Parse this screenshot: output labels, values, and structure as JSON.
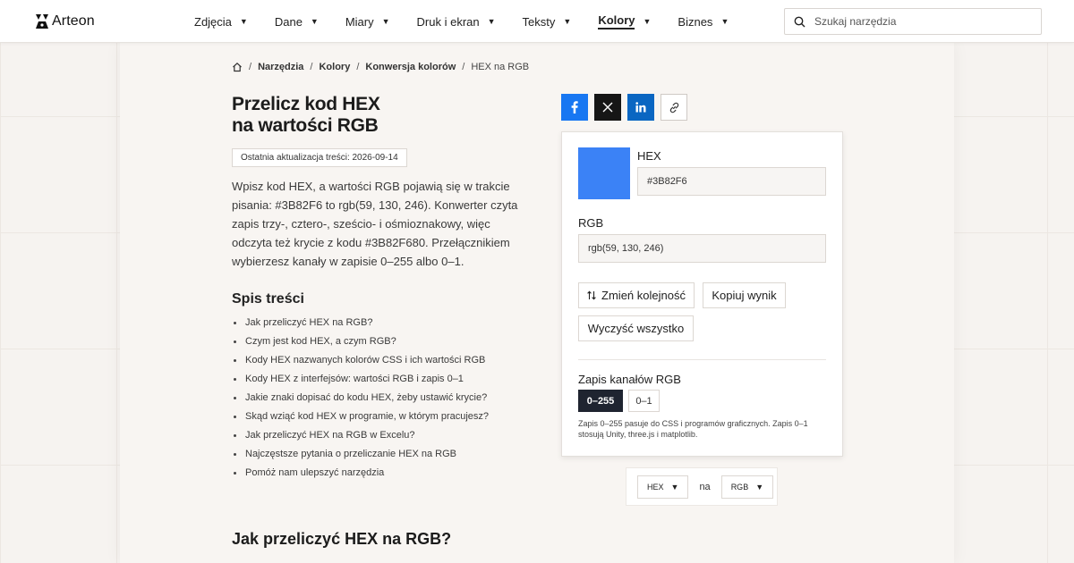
{
  "header": {
    "logo_text": "Arteon",
    "nav": [
      {
        "label": "Zdjęcia",
        "active": false
      },
      {
        "label": "Dane",
        "active": false
      },
      {
        "label": "Miary",
        "active": false
      },
      {
        "label": "Druk i ekran",
        "active": false
      },
      {
        "label": "Teksty",
        "active": false
      },
      {
        "label": "Kolory",
        "active": true
      },
      {
        "label": "Biznes",
        "active": false
      }
    ],
    "search_placeholder": "Szukaj narzędzia"
  },
  "breadcrumb": {
    "items": [
      "Narzędzia",
      "Kolory",
      "Konwersja kolorów"
    ],
    "current": "HEX na RGB"
  },
  "page": {
    "title_line1": "Przelicz kod HEX",
    "title_line2": "na wartości RGB",
    "updated": "Ostatnia aktualizacja treści: 2026-09-14",
    "intro": "Wpisz kod HEX, a wartości RGB pojawią się w trakcie pisania: #3B82F6 to rgb(59, 130, 246). Konwerter czyta zapis trzy-, cztero-, sześcio- i ośmioznakowy, więc odczyta też krycie z kodu #3B82F680. Przełącznikiem wybierzesz kanały w zapisie 0–255 albo 0–1.",
    "toc_title": "Spis treści",
    "toc": [
      "Jak przeliczyć HEX na RGB?",
      "Czym jest kod HEX, a czym RGB?",
      "Kody HEX nazwanych kolorów CSS i ich wartości RGB",
      "Kody HEX z interfejsów: wartości RGB i zapis 0–1",
      "Jakie znaki dopisać do kodu HEX, żeby ustawić krycie?",
      "Skąd wziąć kod HEX w programie, w którym pracujesz?",
      "Jak przeliczyć HEX na RGB w Excelu?",
      "Najczęstsze pytania o przeliczanie HEX na RGB",
      "Pomóż nam ulepszyć narzędzia"
    ],
    "section_heading": "Jak przeliczyć HEX na RGB?"
  },
  "converter": {
    "swatch_color": "#3B82F6",
    "hex_label": "HEX",
    "hex_value": "#3B82F6",
    "rgb_label": "RGB",
    "rgb_value": "rgb(59, 130, 246)",
    "swap_label": "Zmień kolejność",
    "copy_label": "Kopiuj wynik",
    "clear_label": "Wyczyść wszystko",
    "mode_label": "Zapis kanałów RGB",
    "mode_options": [
      "0–255",
      "0–1"
    ],
    "mode_selected": "0–255",
    "note": "Zapis 0–255 pasuje do CSS i programów graficznych. Zapis 0–1 stosują Unity, three.js i matplotlib."
  },
  "direction": {
    "from": "HEX",
    "connector": "na",
    "to": "RGB"
  },
  "colors": {
    "facebook": "#1877f2",
    "x": "#161616",
    "linkedin": "#0a66c2",
    "toggle_active": "#1f2430"
  }
}
